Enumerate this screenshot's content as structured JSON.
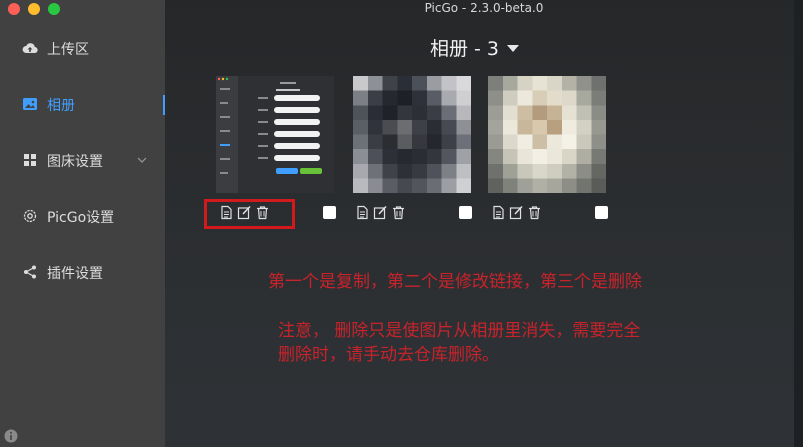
{
  "window": {
    "title": "PicGo - 2.3.0-beta.0"
  },
  "sidebar": {
    "items": [
      {
        "label": "上传区",
        "icon": "cloud-upload-icon"
      },
      {
        "label": "相册",
        "icon": "image-icon",
        "active": true
      },
      {
        "label": "图床设置",
        "icon": "grid-icon",
        "has_submenu": true
      },
      {
        "label": "PicGo设置",
        "icon": "gear-icon"
      },
      {
        "label": "插件设置",
        "icon": "share-icon"
      }
    ],
    "active_color": "#409eff"
  },
  "album": {
    "title": "相册 - 3",
    "images": [
      {
        "kind": "picgo-settings-screenshot",
        "actions": [
          "copy-icon",
          "edit-icon",
          "delete-icon"
        ],
        "checked": false
      },
      {
        "kind": "pixelated-photo-dark",
        "actions": [
          "copy-icon",
          "edit-icon",
          "delete-icon"
        ],
        "checked": false
      },
      {
        "kind": "pixelated-photo-light",
        "actions": [
          "copy-icon",
          "edit-icon",
          "delete-icon"
        ],
        "checked": false
      }
    ]
  },
  "annotations": {
    "line1": "第一个是复制，第二个是修改链接，第三个是删除",
    "line2": "注意，  删除只是使图片从相册里消失，需要完全",
    "line3": "删除时，请手动去仓库删除。",
    "color": "#c8232b"
  }
}
